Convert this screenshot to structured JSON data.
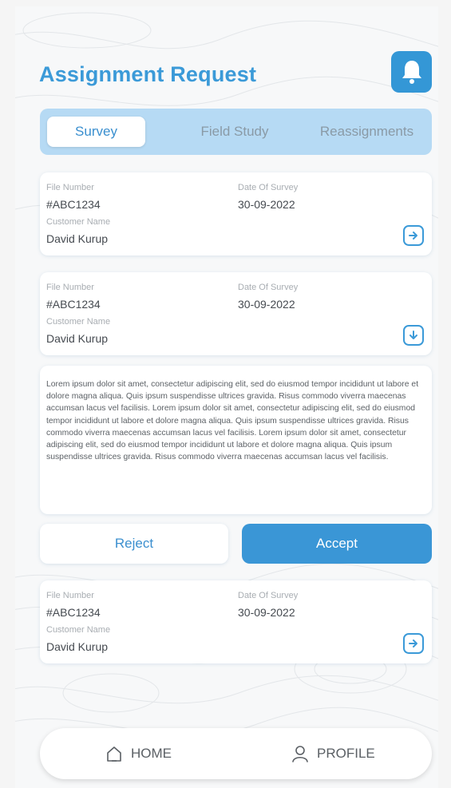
{
  "header": {
    "title": "Assignment Request"
  },
  "icons": {
    "notification": "bell-icon",
    "arrow": "arrow-right-icon",
    "expand": "arrow-down-icon",
    "home": "home-icon",
    "profile": "user-icon"
  },
  "colors": {
    "accent": "#3a96d6",
    "tab_bar": "#b6daf4",
    "text": "#454a50"
  },
  "tabs": [
    {
      "label": "Survey",
      "active": true
    },
    {
      "label": "Field Study",
      "active": false
    },
    {
      "label": "Reassignments",
      "active": false
    }
  ],
  "cards": [
    {
      "file_label": "File Number",
      "file_number": "#ABC1234",
      "date_label": "Date Of Survey",
      "date": "30-09-2022",
      "customer_label": "Customer Name",
      "customer": "David Kurup"
    },
    {
      "file_label": "File Number",
      "file_number": "#ABC1234",
      "date_label": "Date Of Survey",
      "date": "30-09-2022",
      "customer_label": "Customer Name",
      "customer": "David Kurup"
    },
    {
      "file_label": "File Number",
      "file_number": "#ABC1234",
      "date_label": "Date Of Survey",
      "date": "30-09-2022",
      "customer_label": "Customer Name",
      "customer": "David Kurup"
    }
  ],
  "details": {
    "text": "Lorem ipsum dolor sit amet, consectetur adipiscing elit, sed do eiusmod tempor incididunt ut labore et dolore magna aliqua. Quis ipsum suspendisse ultrices gravida. Risus commodo viverra maecenas accumsan lacus vel facilisis. Lorem ipsum dolor sit amet, consectetur adipiscing elit, sed do eiusmod tempor incididunt ut labore et dolore magna aliqua. Quis ipsum suspendisse ultrices gravida. Risus commodo viverra maecenas accumsan lacus vel facilisis. Lorem ipsum dolor sit amet, consectetur adipiscing elit, sed do eiusmod tempor incididunt ut labore et dolore magna aliqua. Quis ipsum suspendisse ultrices gravida. Risus commodo viverra maecenas accumsan lacus vel facilisis."
  },
  "actions": {
    "reject_label": "Reject",
    "accept_label": "Accept"
  },
  "nav": {
    "home_label": "HOME",
    "profile_label": "PROFILE"
  }
}
